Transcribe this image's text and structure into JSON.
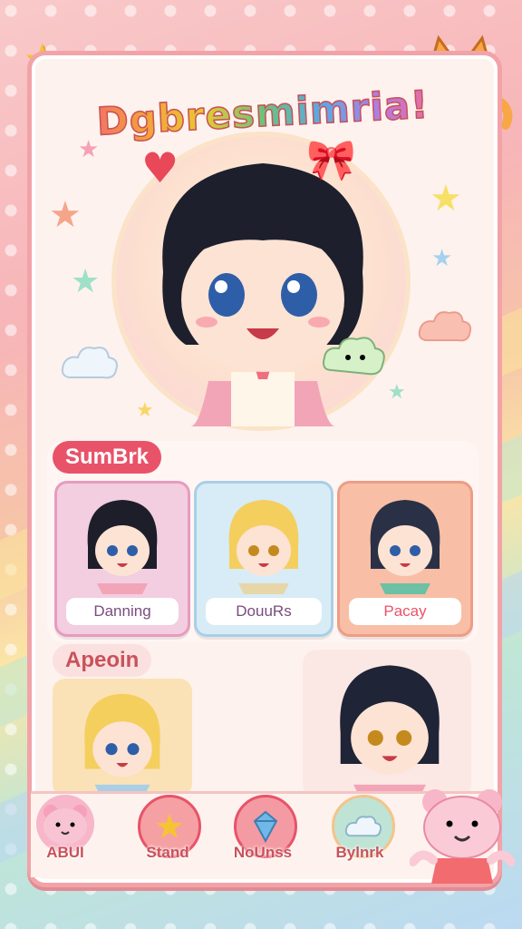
{
  "title": "Dgbresmimria!",
  "sections": {
    "first": "SumBrk",
    "second": "Apeoin"
  },
  "cards": [
    {
      "label": "Danning",
      "hair": "#1e1e2a",
      "bg": "#f3cde0",
      "border": "#e79bbf"
    },
    {
      "label": "DouuRs",
      "hair": "#f4cf5e",
      "bg": "#d7ecf6",
      "border": "#a9cfe6"
    },
    {
      "label": "Pacay",
      "hair": "#2a3146",
      "bg": "#f8bfa6",
      "border": "#ef9c86"
    }
  ],
  "nav": [
    {
      "label": "ABUI",
      "icon": "bear-icon",
      "color": "#f7b6c9"
    },
    {
      "label": "Stand",
      "icon": "star-icon",
      "color": "#f5a0a3"
    },
    {
      "label": "NoUnss",
      "icon": "gem-icon",
      "color": "#f49aa2"
    },
    {
      "label": "Bylnrk",
      "icon": "cloud-icon",
      "color": "#bfe3d5"
    }
  ],
  "colors": {
    "accent": "#e8536a",
    "panel": "#fdf2ee",
    "border": "#f2a3a8"
  }
}
